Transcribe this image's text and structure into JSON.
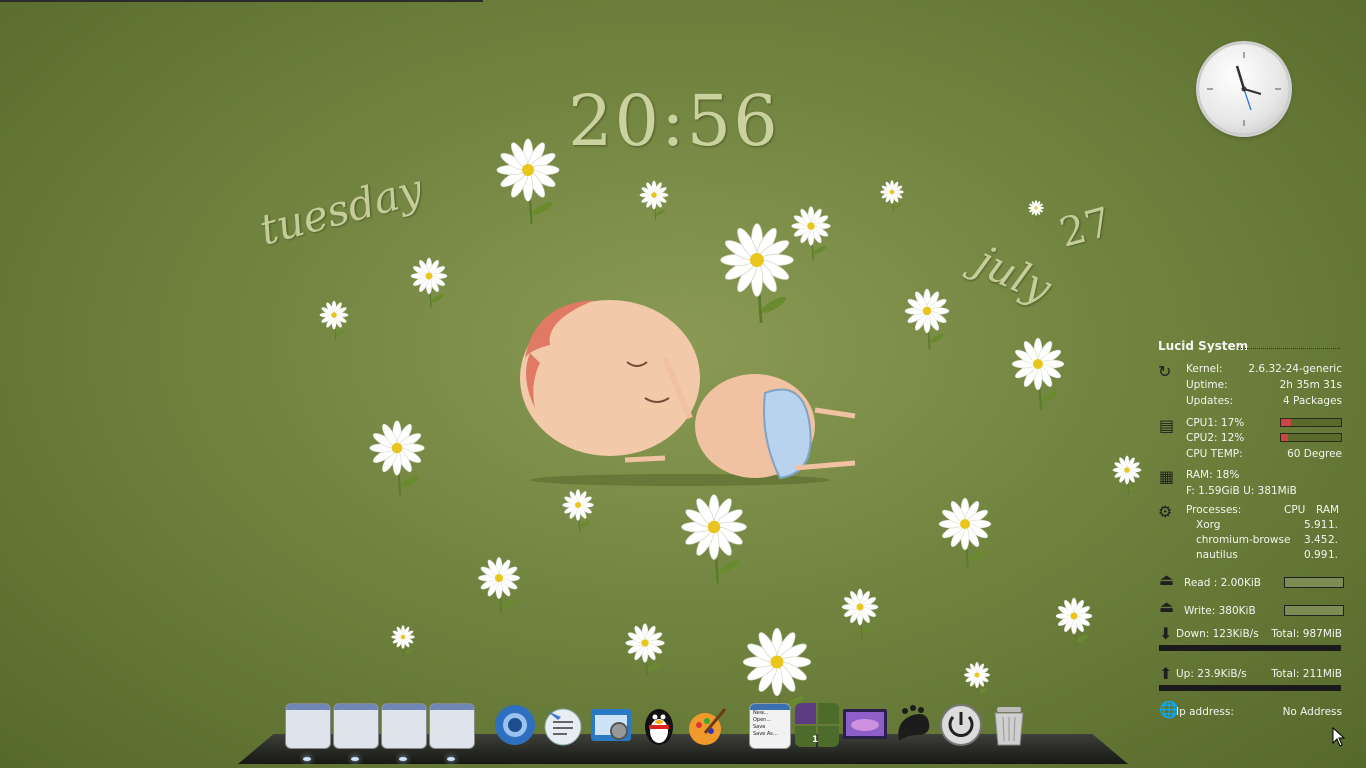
{
  "desktop": {
    "time": "20:56",
    "weekday": "tuesday",
    "day": "27",
    "month": "july"
  },
  "sysmon": {
    "title": "Lucid System",
    "kernel_label": "Kernel:",
    "kernel_value": "2.6.32-24-generic",
    "uptime_label": "Uptime:",
    "uptime_value": "2h 35m 31s",
    "updates_label": "Updates:",
    "updates_count": "4",
    "updates_unit": "Packages",
    "cpu1_label": "CPU1:",
    "cpu1_value": "17%",
    "cpu1_fraction": 0.17,
    "cpu2_label": "CPU2:",
    "cpu2_value": "12%",
    "cpu2_fraction": 0.12,
    "cpu_temp_label": "CPU TEMP:",
    "cpu_temp_value": "60",
    "cpu_temp_unit": "Degree",
    "ram_label": "RAM:",
    "ram_value": "18%",
    "memory_line": "F: 1.59GiB U: 381MiB",
    "processes_label": "Processes:",
    "col_cpu": "CPU",
    "col_ram": "RAM",
    "processes": [
      {
        "name": "Xorg",
        "cpu": "5.91",
        "ram": "1."
      },
      {
        "name": "chromium-browse",
        "cpu": "3.45",
        "ram": "2."
      },
      {
        "name": "nautilus",
        "cpu": "0.99",
        "ram": "1."
      }
    ],
    "read_label": "Read : 2.00KiB",
    "write_label": "Write: 380KiB",
    "down_label": "Down: 123KiB/s",
    "down_total": "Total: 987MiB",
    "up_label": "Up: 23.9KiB/s",
    "up_total": "Total: 211MiB",
    "ip_label": "Ip address:",
    "ip_value": "No Address"
  },
  "dock": {
    "workspace_badge": "1",
    "file_menu": [
      "New...",
      "Open...",
      "Save",
      "Save As..."
    ],
    "items": [
      {
        "name": "window-thumb-1",
        "icon": "window-thumbnail"
      },
      {
        "name": "window-thumb-2",
        "icon": "window-thumbnail"
      },
      {
        "name": "window-thumb-3",
        "icon": "window-thumbnail"
      },
      {
        "name": "window-thumb-4",
        "icon": "window-thumbnail"
      },
      {
        "name": "chromium",
        "icon": "chromium-icon"
      },
      {
        "name": "text-editor",
        "icon": "gedit-icon"
      },
      {
        "name": "photo-viewer",
        "icon": "camera-icon"
      },
      {
        "name": "qq",
        "icon": "penguin-icon"
      },
      {
        "name": "graphics-app",
        "icon": "paint-icon"
      },
      {
        "name": "file-menu",
        "icon": "document-menu-icon"
      },
      {
        "name": "workspace-switcher",
        "icon": "workspace-icon"
      },
      {
        "name": "display-settings",
        "icon": "monitor-icon"
      },
      {
        "name": "gnome-menu",
        "icon": "gnome-foot-icon"
      },
      {
        "name": "shutdown",
        "icon": "power-icon"
      },
      {
        "name": "trash",
        "icon": "trash-icon"
      }
    ]
  },
  "colors": {
    "wallpaper": "#71843f",
    "conky_text": "#f4f4f0",
    "gauge_fill": "#cc4444",
    "dock": "#1a1a1a"
  }
}
